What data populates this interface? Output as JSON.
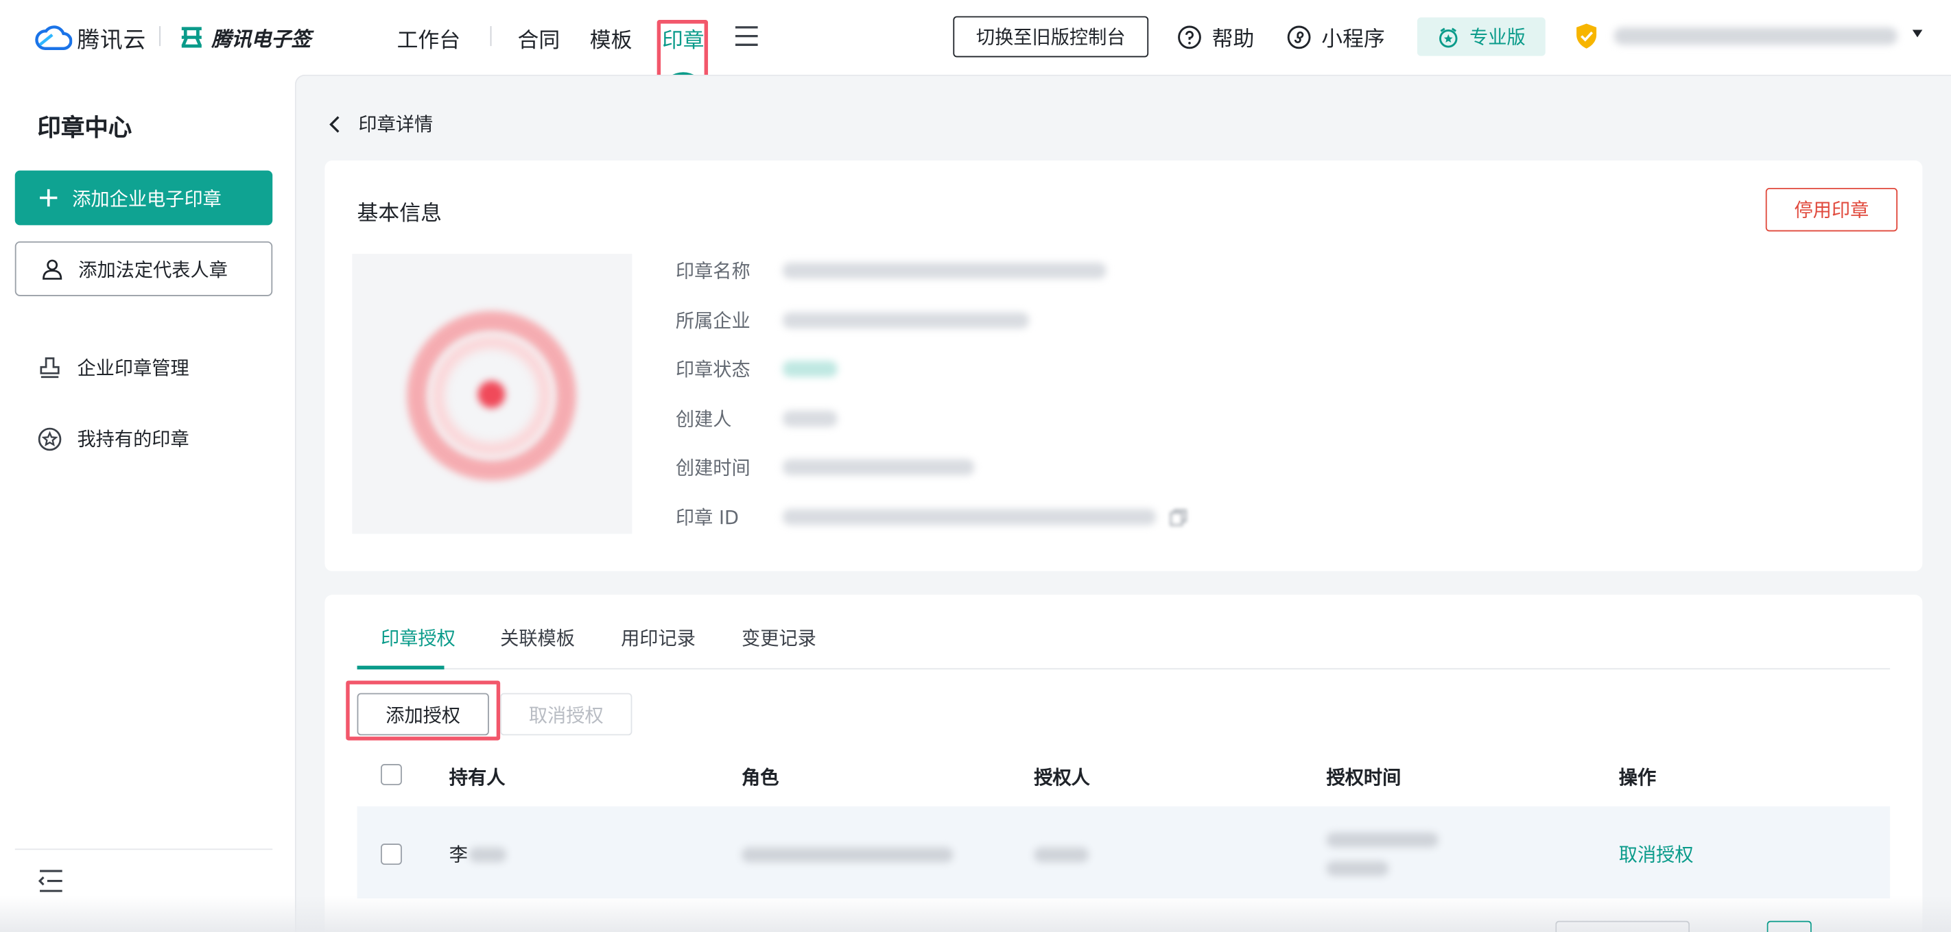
{
  "header": {
    "brand_cloud": "腾讯云",
    "brand_esign": "腾讯电子签",
    "nav": [
      {
        "label": "工作台"
      },
      {
        "label": "合同"
      },
      {
        "label": "模板"
      },
      {
        "label": "印章",
        "active": true
      }
    ],
    "switch_old": "切换至旧版控制台",
    "help": "帮助",
    "mini_program": "小程序",
    "edition": "专业版",
    "accent_color": "#0a9b8a",
    "highlight_color": "#f2576b"
  },
  "sidebar": {
    "title": "印章中心",
    "add_company_seal": "添加企业电子印章",
    "add_legal_rep_seal": "添加法定代表人章",
    "links": [
      {
        "label": "企业印章管理",
        "icon": "stamp-icon"
      },
      {
        "label": "我持有的印章",
        "icon": "star-badge-icon"
      }
    ]
  },
  "main": {
    "breadcrumb": "印章详情",
    "basic_info": {
      "title": "基本信息",
      "disable_button": "停用印章",
      "fields": [
        {
          "label": "印章名称"
        },
        {
          "label": "所属企业"
        },
        {
          "label": "印章状态"
        },
        {
          "label": "创建人"
        },
        {
          "label": "创建时间"
        },
        {
          "label": "印章 ID"
        }
      ]
    },
    "tabs": [
      {
        "label": "印章授权",
        "active": true
      },
      {
        "label": "关联模板"
      },
      {
        "label": "用印记录"
      },
      {
        "label": "变更记录"
      }
    ],
    "actions": {
      "add_auth": "添加授权",
      "cancel_auth": "取消授权"
    },
    "table": {
      "columns": [
        "持有人",
        "角色",
        "授权人",
        "授权时间",
        "操作"
      ],
      "rows": [
        {
          "holder_prefix": "李",
          "action": "取消授权"
        }
      ]
    }
  }
}
